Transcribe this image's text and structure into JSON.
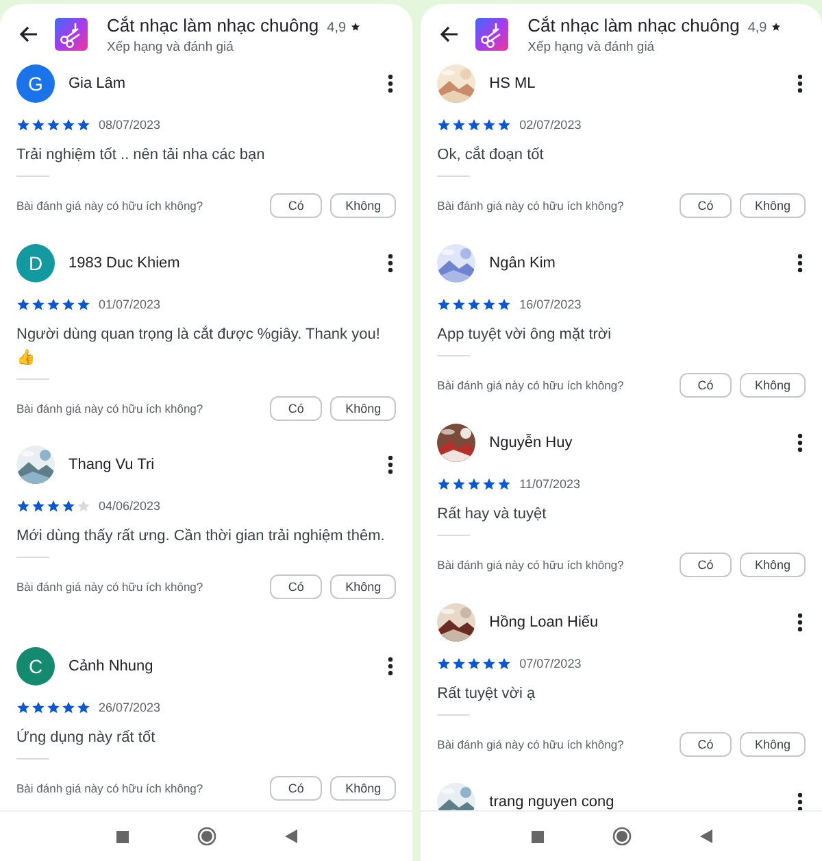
{
  "panels": [
    {
      "header": {
        "title": "Cắt nhạc làm nhạc chuông",
        "rating": "4,9",
        "subtitle": "Xếp hạng và đánh giá"
      },
      "reviews": [
        {
          "name": "Gia Lâm",
          "avatar": {
            "kind": "letter",
            "letter": "G",
            "color": "#1a73e8"
          },
          "stars": 5,
          "date": "08/07/2023",
          "text": "Trải nghiệm tốt .. nên tải nha các bạn",
          "question": "Bài đánh giá này có hữu ích không?",
          "buttons": [
            "Có",
            "Không"
          ]
        },
        {
          "name": "1983 Duc Khiem",
          "avatar": {
            "kind": "letter",
            "letter": "D",
            "color": "#129aa0"
          },
          "stars": 5,
          "date": "01/07/2023",
          "text": "Người dùng quan trọng là cắt được %giây. Thank you! 👍",
          "question": "Bài đánh giá này có hữu ích không?",
          "buttons": [
            "Có",
            "Không"
          ]
        },
        {
          "name": "Thang Vu Tri",
          "stars": 4,
          "date": "04/06/2023",
          "text": "Mới dùng thấy rất ưng. Cần thời gian trải nghiệm thêm.",
          "question": "Bài đánh giá này có hữu ích không?",
          "buttons": [
            "Có",
            "Không"
          ]
        },
        {
          "name": "Cảnh Nhung",
          "avatar": {
            "kind": "letter",
            "letter": "C",
            "color": "#148a70"
          },
          "stars": 5,
          "date": "26/07/2023",
          "text": "Ứng dụng này rất tốt",
          "question": "Bài đánh giá này có hữu ích không?",
          "buttons": [
            "Có",
            "Không"
          ]
        }
      ]
    },
    {
      "header": {
        "title": "Cắt nhạc làm nhạc chuông",
        "rating": "4,9",
        "subtitle": "Xếp hạng và đánh giá"
      },
      "reviews": [
        {
          "name": "HS ML",
          "stars": 5,
          "date": "02/07/2023",
          "text": "Ok, cắt đoạn tốt",
          "question": "Bài đánh giá này có hữu ích không?",
          "buttons": [
            "Có",
            "Không"
          ]
        },
        {
          "name": "Ngân Kim",
          "stars": 5,
          "date": "16/07/2023",
          "text": "App tuyệt vời ông mặt trời",
          "question": "Bài đánh giá này có hữu ích không?",
          "buttons": [
            "Có",
            "Không"
          ]
        },
        {
          "name": "Nguyễn Huy",
          "stars": 5,
          "date": "11/07/2023",
          "text": "Rất hay và tuyệt",
          "question": "Bài đánh giá này có hữu ích không?",
          "buttons": [
            "Có",
            "Không"
          ]
        },
        {
          "name": "Hồng Loan Hiếu",
          "stars": 5,
          "date": "07/07/2023",
          "text": "Rất tuyệt vời ạ",
          "question": "Bài đánh giá này có hữu ích không?",
          "buttons": [
            "Có",
            "Không"
          ]
        },
        {
          "name": "trang nguyen cong"
        }
      ]
    }
  ]
}
